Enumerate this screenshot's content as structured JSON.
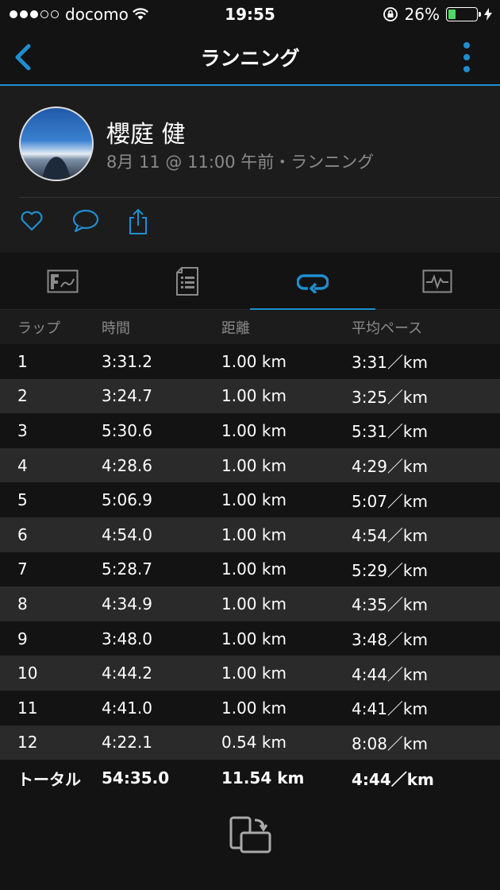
{
  "status": {
    "carrier": "docomo",
    "time": "19:55",
    "battery": "26%"
  },
  "nav": {
    "title": "ランニング"
  },
  "profile": {
    "name": "櫻庭 健",
    "meta": "8月 11 @ 11:00 午前・ランニング"
  },
  "colors": {
    "accent": "#1f8ecf",
    "battery": "#4cd964"
  },
  "table": {
    "headers": [
      "ラップ",
      "時間",
      "距離",
      "平均ペース"
    ],
    "rows": [
      [
        "1",
        "3:31.2",
        "1.00 km",
        "3:31／km"
      ],
      [
        "2",
        "3:24.7",
        "1.00 km",
        "3:25／km"
      ],
      [
        "3",
        "5:30.6",
        "1.00 km",
        "5:31／km"
      ],
      [
        "4",
        "4:28.6",
        "1.00 km",
        "4:29／km"
      ],
      [
        "5",
        "5:06.9",
        "1.00 km",
        "5:07／km"
      ],
      [
        "6",
        "4:54.0",
        "1.00 km",
        "4:54／km"
      ],
      [
        "7",
        "5:28.7",
        "1.00 km",
        "5:29／km"
      ],
      [
        "8",
        "4:34.9",
        "1.00 km",
        "4:35／km"
      ],
      [
        "9",
        "3:48.0",
        "1.00 km",
        "3:48／km"
      ],
      [
        "10",
        "4:44.2",
        "1.00 km",
        "4:44／km"
      ],
      [
        "11",
        "4:41.0",
        "1.00 km",
        "4:41／km"
      ],
      [
        "12",
        "4:22.1",
        "0.54 km",
        "8:08／km"
      ]
    ],
    "total": [
      "トータル",
      "54:35.0",
      "11.54 km",
      "4:44／km"
    ]
  },
  "icons": {
    "back": "chevron-left-icon",
    "more": "more-vertical-icon",
    "like": "heart-icon",
    "comment": "comment-icon",
    "share": "share-icon",
    "tabs": [
      "map-icon",
      "details-icon",
      "laps-icon",
      "charts-icon"
    ],
    "rotate": "rotate-screen-icon"
  }
}
